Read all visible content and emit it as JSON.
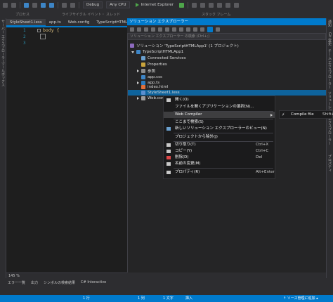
{
  "toolbar": {
    "config": "Debug",
    "platform": "Any CPU",
    "run_target": "Internet Explorer",
    "faded_1": "プロセス",
    "faded_2": "ライフサイクル イベント・ スレッド",
    "faded_3": "スタック フレーム"
  },
  "left_strip": {
    "tab1": "サーバー エクスプローラー",
    "tab2": "ツールボックス"
  },
  "right_strip": {
    "tab1": "通知",
    "tab2": "Git 変更",
    "tab3": "チーム エクスプローラー",
    "tab4": "ソリューション エクスプローラー",
    "tab5": "プロパティ"
  },
  "doc_tabs": [
    "StyleSheet1.less",
    "app.ts",
    "Web.config",
    "TypeScriptHTMLApp1"
  ],
  "editor": {
    "lines": [
      "1",
      "2",
      "3"
    ],
    "code_line1": "body {",
    "zoom": "145 %"
  },
  "solution_explorer": {
    "title": "ソリューション エクスプローラー",
    "search_placeholder": "ソリューション エクスプローラー の検索 (Ctrl+;)",
    "tree": [
      "ソリューション 'TypeScriptHTMLApp1' (1 プロジェクト)",
      "TypeScriptHTMLApp1",
      "Connected Services",
      "Properties",
      "参照",
      "app.css",
      "app.ts",
      "index.html",
      "StyleSheet1.less",
      "Web.config"
    ]
  },
  "context_menu": {
    "items": [
      {
        "label": "開く(O)",
        "shortcut": ""
      },
      {
        "label": "ファイルを開くアプリケーションの選択(N)...",
        "shortcut": ""
      },
      {
        "label": "Web Compiler",
        "shortcut": ""
      },
      {
        "label": "ここまで検索(S)",
        "shortcut": ""
      },
      {
        "label": "新しいソリューション エクスプローラーのビュー(N)",
        "shortcut": ""
      },
      {
        "label": "プロジェクトから除外(J)",
        "shortcut": ""
      },
      {
        "label": "切り取り(T)",
        "shortcut": "Ctrl+X"
      },
      {
        "label": "コピー(Y)",
        "shortcut": "Ctrl+C"
      },
      {
        "label": "削除(D)",
        "shortcut": "Del"
      },
      {
        "label": "名前の変更(M)",
        "shortcut": ""
      },
      {
        "label": "プロパティ(R)",
        "shortcut": "Alt+Enter"
      }
    ],
    "submenu": {
      "label": "Compile file",
      "shortcut": "Shift+"
    }
  },
  "bottom_tabs": [
    "エラー一覧",
    "出力",
    "シンボルの検索結果",
    "C# Interactive"
  ],
  "status_bar": {
    "line": "1 行",
    "col": "1 列",
    "char": "1 文字",
    "mode": "挿入",
    "source_control": "↑ ソース管理に追加 ▴"
  },
  "colors": {
    "accent": "#007acc",
    "selection": "#0e639c",
    "editor_bg": "#1e1e1e",
    "menu_bg": "#1b1b1c"
  }
}
